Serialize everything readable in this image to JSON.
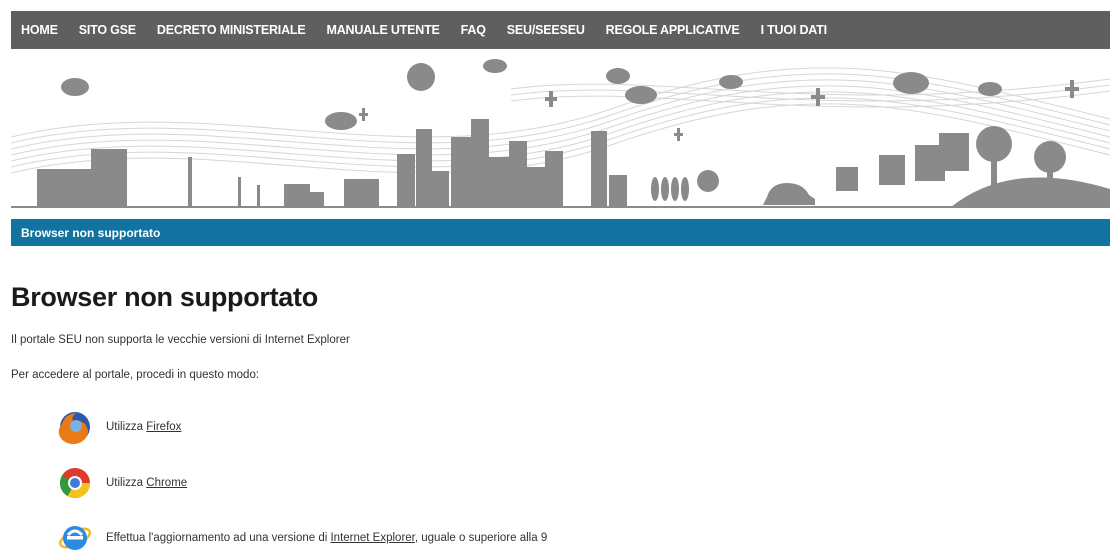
{
  "nav": {
    "items": [
      "HOME",
      "SITO GSE",
      "DECRETO MINISTERIALE",
      "MANUALE UTENTE",
      "FAQ",
      "SEU/SEESEU",
      "REGOLE APPLICATIVE",
      "I TUOI DATI"
    ]
  },
  "breadcrumb": {
    "label": "Browser non supportato"
  },
  "page": {
    "title": "Browser non supportato",
    "intro": "Il portale SEU non supporta le vecchie versioni di Internet Explorer",
    "instructions": "Per accedere al portale, procedi in questo modo:"
  },
  "options": [
    {
      "prefix": "Utilizza ",
      "link": "Firefox",
      "suffix": "",
      "icon": "firefox-icon"
    },
    {
      "prefix": "Utilizza ",
      "link": "Chrome",
      "suffix": "",
      "icon": "chrome-icon"
    },
    {
      "prefix": "Effettua l'aggiornamento ad una versione di ",
      "link": "Internet Explorer",
      "suffix": ", uguale o superiore alla 9",
      "icon": "internet-explorer-icon"
    }
  ],
  "colors": {
    "nav_bg": "#5f5f5f",
    "subbar_bg": "#1272a0",
    "illustration_gray": "#8a8a8a"
  }
}
